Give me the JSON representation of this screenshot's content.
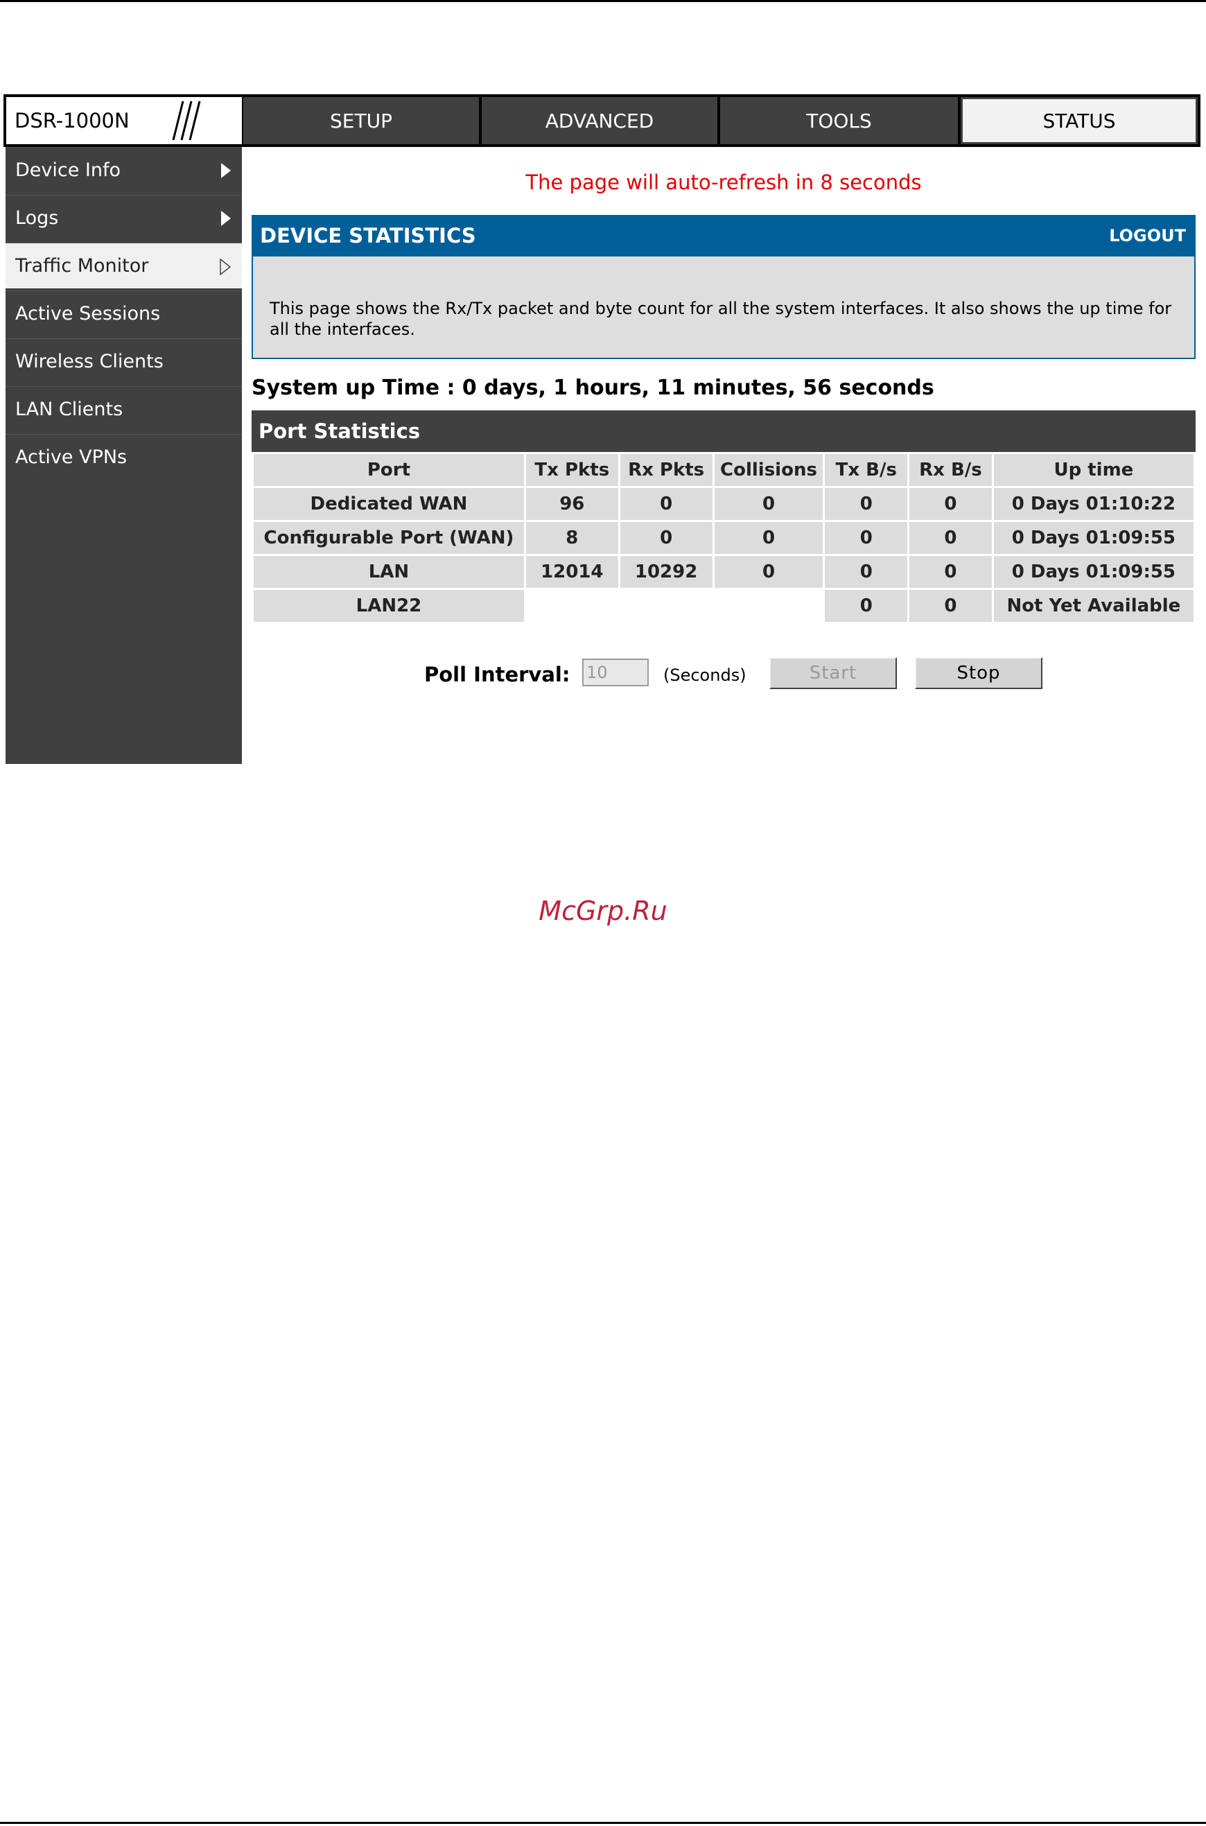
{
  "nav": {
    "logo": "DSR-1000N",
    "tabs": [
      {
        "label": "SETUP"
      },
      {
        "label": "ADVANCED"
      },
      {
        "label": "TOOLS"
      },
      {
        "label": "STATUS"
      }
    ]
  },
  "sidebar": {
    "items": [
      {
        "label": "Device Info"
      },
      {
        "label": "Logs"
      },
      {
        "label": "Traffic Monitor"
      },
      {
        "label": "Active Sessions"
      },
      {
        "label": "Wireless Clients"
      },
      {
        "label": "LAN Clients"
      },
      {
        "label": "Active VPNs"
      }
    ]
  },
  "main": {
    "refresh_notice": "The page will auto-refresh in 8 seconds",
    "panel_title": "DEVICE STATISTICS",
    "logout": "LOGOUT",
    "description": "This page shows the Rx/Tx packet and byte count for all the system interfaces. It also shows the up time for all the interfaces.",
    "uptime": "System up Time : 0 days, 1 hours, 11 minutes, 56 seconds",
    "port_stats_title": "Port Statistics",
    "columns": [
      "Port",
      "Tx Pkts",
      "Rx Pkts",
      "Collisions",
      "Tx B/s",
      "Rx B/s",
      "Up time"
    ],
    "rows": [
      [
        "Dedicated WAN",
        "96",
        "0",
        "0",
        "0",
        "0",
        "0 Days 01:10:22"
      ],
      [
        "Configurable Port (WAN)",
        "8",
        "0",
        "0",
        "0",
        "0",
        "0 Days 01:09:55"
      ],
      [
        "LAN",
        "12014",
        "10292",
        "0",
        "0",
        "0",
        "0 Days 01:09:55"
      ],
      [
        "LAN22",
        "",
        "",
        "",
        "0",
        "0",
        "Not Yet Available"
      ]
    ],
    "poll": {
      "label": "Poll Interval:",
      "value": "10",
      "unit": "(Seconds)",
      "start": "Start",
      "stop": "Stop"
    }
  },
  "watermark": "McGrp.Ru"
}
